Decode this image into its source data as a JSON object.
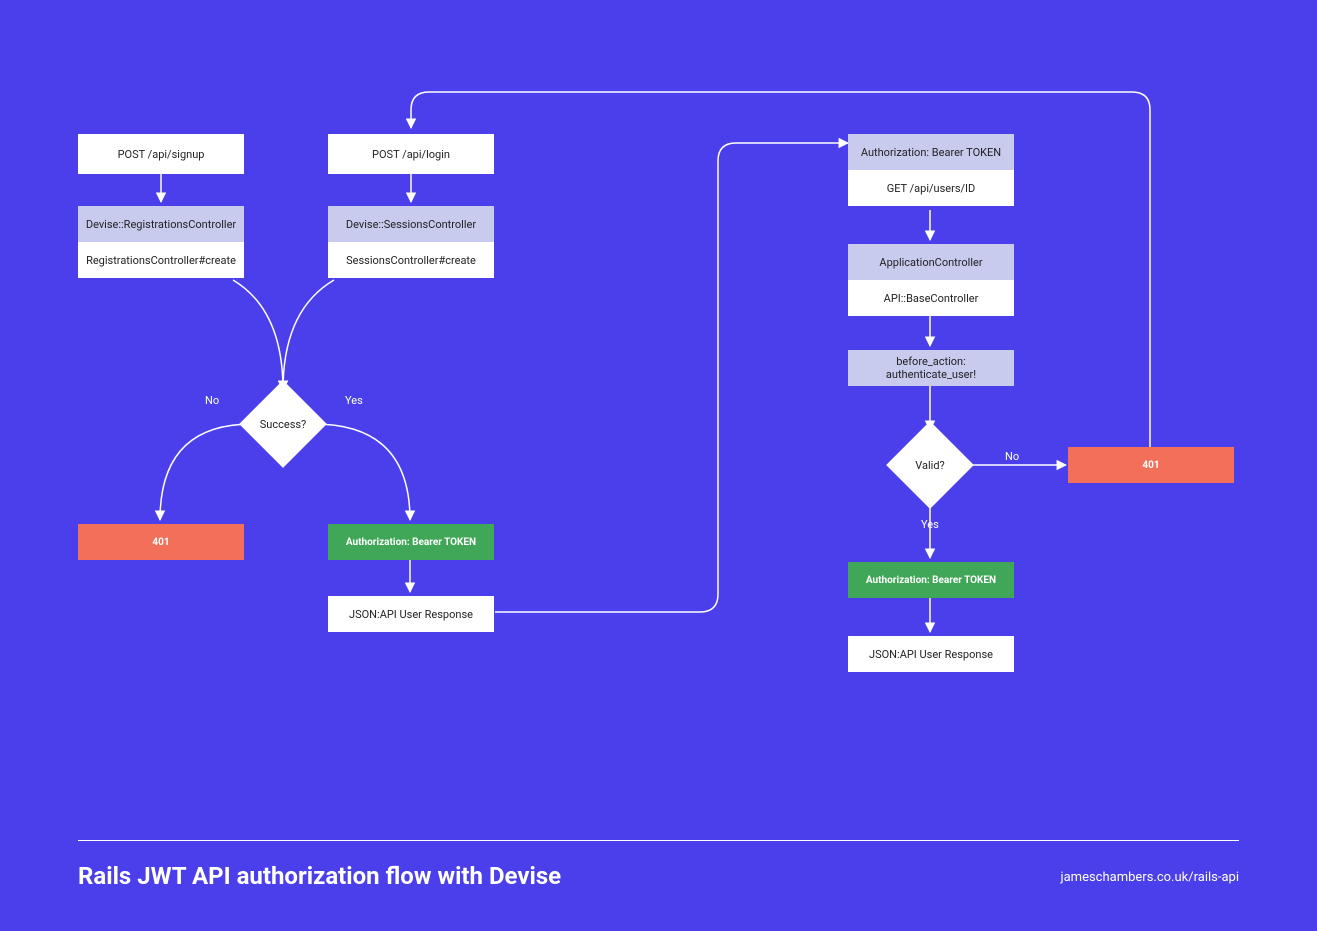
{
  "colors": {
    "bg": "#4a3feb",
    "lilac": "#c8caee",
    "green": "#3fa757",
    "coral": "#f27059"
  },
  "left": {
    "signup": {
      "post": "POST /api/signup",
      "super": "Devise::RegistrationsController",
      "action": "RegistrationsController#create"
    },
    "login": {
      "post": "POST /api/login",
      "super": "Devise::SessionsController",
      "action": "SessionsController#create"
    },
    "decision": {
      "q": "Success?",
      "no": "No",
      "yes": "Yes"
    },
    "fail": "401",
    "ok": "Authorization: Bearer TOKEN",
    "resp": "JSON:API User Response"
  },
  "right": {
    "header": "Authorization: Bearer TOKEN",
    "get": "GET /api/users/ID",
    "app": "ApplicationController",
    "base": "API::BaseController",
    "before": "before_action: authenticate_user!",
    "decision": {
      "q": "Valid?",
      "no": "No",
      "yes": "Yes"
    },
    "fail": "401",
    "ok": "Authorization: Bearer TOKEN",
    "resp": "JSON:API User Response"
  },
  "footer": {
    "title": "Rails JWT API authorization flow with Devise",
    "link": "jameschambers.co.uk/rails-api"
  }
}
